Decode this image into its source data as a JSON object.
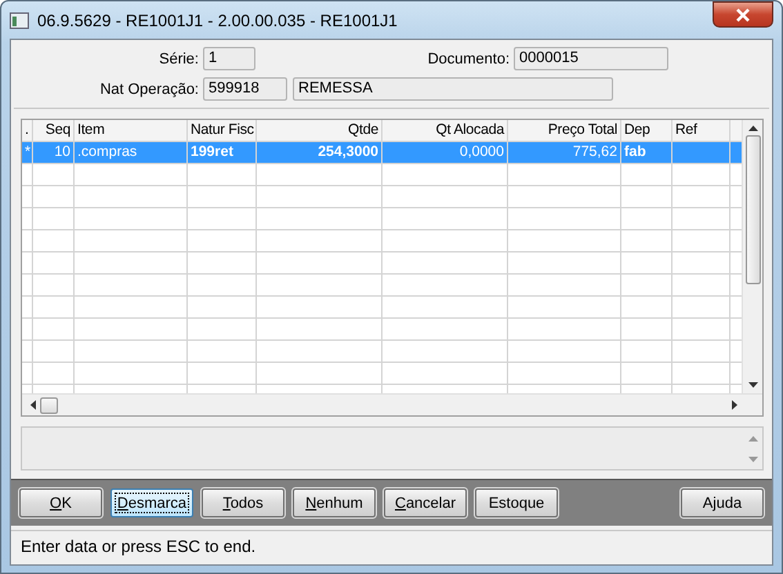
{
  "window": {
    "title": "06.9.5629 - RE1001J1 - 2.00.00.035 - RE1001J1"
  },
  "header": {
    "serie_label": "Série:",
    "serie": "1",
    "documento_label": "Documento:",
    "documento": "0000015",
    "nat_label": "Nat Operação:",
    "nat_code": "599918",
    "nat_desc": "REMESSA"
  },
  "table": {
    "columns": [
      {
        "label": ".",
        "kind": "text"
      },
      {
        "label": "Seq",
        "kind": "number"
      },
      {
        "label": "Item",
        "kind": "text"
      },
      {
        "label": "Natur Fisc",
        "kind": "bold-text"
      },
      {
        "label": "Qtde",
        "kind": "bold-number"
      },
      {
        "label": "Qt Alocada",
        "kind": "number"
      },
      {
        "label": "Preço Total",
        "kind": "number"
      },
      {
        "label": "Dep",
        "kind": "bold-text"
      },
      {
        "label": "Ref",
        "kind": "text"
      }
    ],
    "rows": [
      {
        "selected": true,
        "cells": [
          "*",
          "10",
          ".compras",
          "199ret",
          "254,3000",
          "0,0000",
          "775,62",
          "fab",
          null
        ]
      }
    ]
  },
  "buttons": [
    {
      "kind": "action",
      "mnemonic": "O",
      "rest": "K",
      "focused": false
    },
    {
      "kind": "action",
      "mnemonic": "D",
      "rest": "esmarca",
      "focused": true
    },
    {
      "kind": "action",
      "mnemonic": "T",
      "rest": "odos",
      "focused": false
    },
    {
      "kind": "action",
      "mnemonic": "N",
      "rest": "enhum",
      "focused": false
    },
    {
      "kind": "action",
      "mnemonic": "C",
      "rest": "ancelar",
      "focused": false
    },
    {
      "kind": "action",
      "label": "Estoque",
      "focused": false
    },
    {
      "kind": "help",
      "label": "Ajuda",
      "focused": false
    }
  ],
  "status_bar": "Enter data or press ESC to end."
}
